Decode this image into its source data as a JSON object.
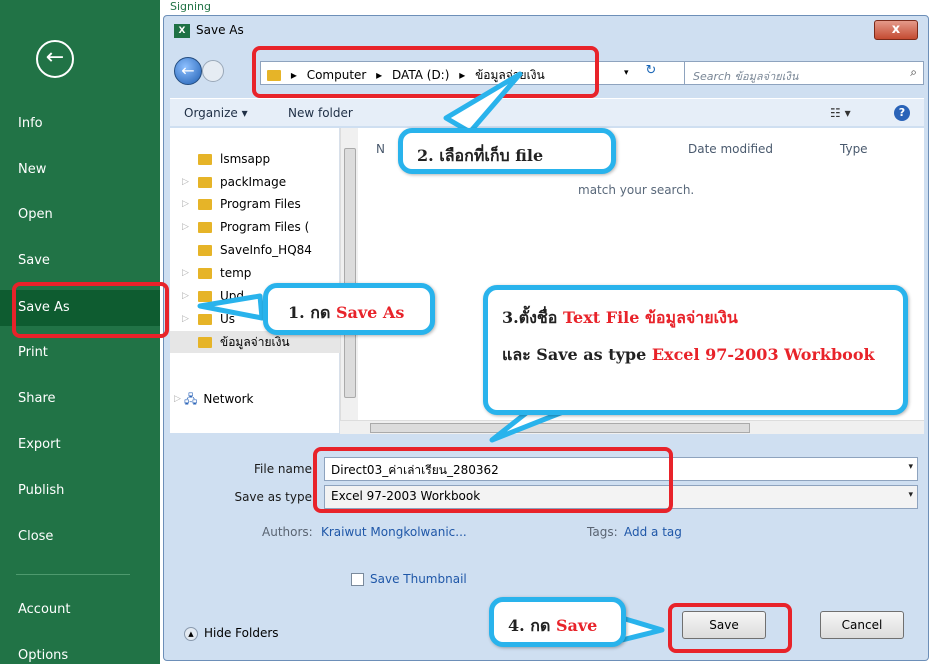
{
  "backstage": {
    "top_label": "Signing",
    "nav": [
      "Info",
      "New",
      "Open",
      "Save",
      "Save As",
      "Print",
      "Share",
      "Export",
      "Publish",
      "Close",
      "Account",
      "Options"
    ]
  },
  "dialog": {
    "title": "Save As",
    "app_icon": "X",
    "close": "x",
    "address": [
      "Computer",
      "DATA (D:)",
      "ข้อมูลจ่ายเงิน"
    ],
    "search_placeholder": "Search ข้อมูลจ่ายเงิน",
    "toolbar": {
      "organize": "Organize ▾",
      "new_folder": "New folder"
    },
    "tree": [
      "lsmsapp",
      "packImage",
      "Program Files",
      "Program Files (",
      "SaveInfo_HQ84",
      "temp",
      "Upd",
      "Us",
      "ข้อมูลจ่ายเงิน"
    ],
    "network": "Network",
    "columns": {
      "name": "N",
      "date": "Date modified",
      "type": "Type"
    },
    "empty_message": "match your search.",
    "file_name_label": "File name:",
    "file_name_value": "Direct03_ค่าเล่าเรียน_280362",
    "save_type_label": "Save as type:",
    "save_type_value": "Excel 97-2003 Workbook",
    "authors_label": "Authors:",
    "authors_value": "Kraiwut Mongkolwanic...",
    "tags_label": "Tags:",
    "tags_value": "Add a tag",
    "thumbnail_label": "Save Thumbnail",
    "hide_folders": "Hide Folders",
    "save_button": "Save",
    "cancel_button": "Cancel"
  },
  "annotations": {
    "step1_prefix": "1. กด",
    "step1_red": "Save As",
    "step2": "2. เลือกที่เก็บ file",
    "step3_line1_prefix": "3.ตั้งชื่อ",
    "step3_line1_red": "Text File ข้อมูลจ่ายเงิน",
    "step3_line2_prefix": "และ Save as type",
    "step3_line2_red": "Excel 97-2003 Workbook",
    "step4_prefix": "4. กด",
    "step4_red": "Save"
  },
  "colors": {
    "excel_green": "#217346",
    "annotation_red": "#e8232a",
    "callout_blue": "#29b3ec"
  }
}
